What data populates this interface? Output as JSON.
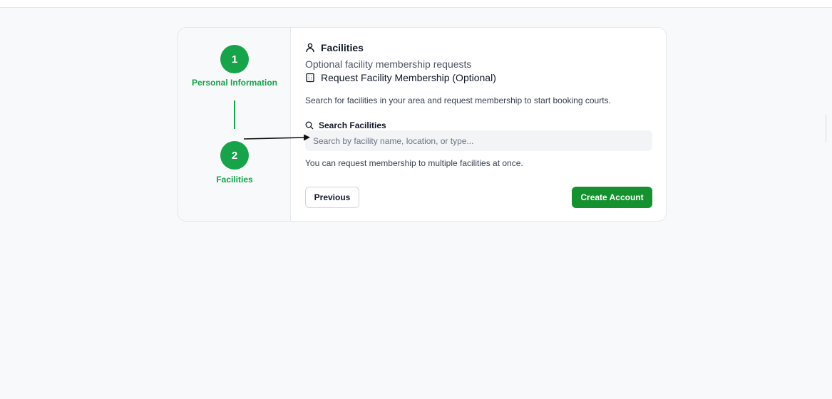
{
  "stepper": {
    "steps": [
      {
        "number": "1",
        "label": "Personal Information"
      },
      {
        "number": "2",
        "label": "Facilities"
      }
    ]
  },
  "section": {
    "icon": "user-icon",
    "title": "Facilities",
    "subtitle": "Optional facility membership requests"
  },
  "membership": {
    "icon": "building-icon",
    "heading": "Request Facility Membership (Optional)",
    "description": "Search for facilities in your area and request membership to start booking courts."
  },
  "search": {
    "icon": "search-icon",
    "label": "Search Facilities",
    "placeholder": "Search by facility name, location, or type...",
    "value": ""
  },
  "hint": "You can request membership to multiple facilities at once.",
  "actions": {
    "previous_label": "Previous",
    "create_label": "Create Account"
  },
  "colors": {
    "accent": "#16a34a",
    "primary_button": "#15922f",
    "background": "#f8f9fb"
  }
}
